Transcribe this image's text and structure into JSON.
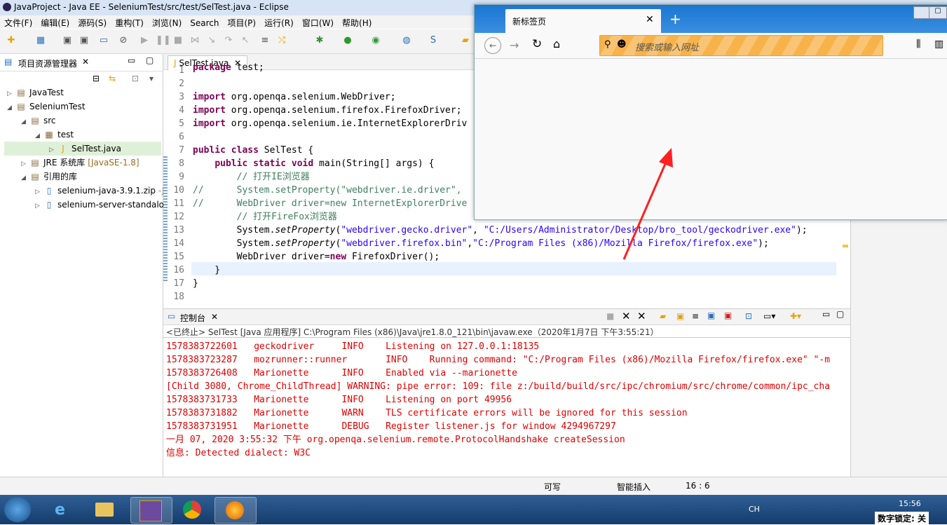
{
  "eclipse": {
    "title": "JavaProject - Java EE - SeleniumTest/src/test/SelTest.java - Eclipse",
    "menu": [
      "文件(F)",
      "编辑(E)",
      "源码(S)",
      "重构(T)",
      "浏览(N)",
      "Search",
      "项目(P)",
      "运行(R)",
      "窗口(W)",
      "帮助(H)"
    ],
    "explorer": {
      "title": "项目资源管理器",
      "items": [
        {
          "label": "JavaTest",
          "indent": 0,
          "arrow": "▷"
        },
        {
          "label": "SeleniumTest",
          "indent": 0,
          "arrow": "◢"
        },
        {
          "label": "src",
          "indent": 1,
          "arrow": "◢"
        },
        {
          "label": "test",
          "indent": 2,
          "arrow": "◢"
        },
        {
          "label": "SelTest.java",
          "indent": 3,
          "arrow": "▷"
        },
        {
          "label": "JRE 系统库",
          "suffix": "[JavaSE-1.8]",
          "indent": 1,
          "arrow": "▷"
        },
        {
          "label": "引用的库",
          "indent": 1,
          "arrow": "◢"
        },
        {
          "label": "selenium-java-3.9.1.zip",
          "suffix": "-Ja",
          "indent": 2,
          "arrow": "▷"
        },
        {
          "label": "selenium-server-standalo",
          "indent": 2,
          "arrow": "▷"
        }
      ]
    },
    "editor_tab": "SelTest.java",
    "code": [
      {
        "n": "1",
        "html": "package test;"
      },
      {
        "n": "2",
        "html": ""
      },
      {
        "n": "3",
        "html": "import org.openqa.selenium.WebDriver;"
      },
      {
        "n": "4",
        "html": "import org.openqa.selenium.firefox.FirefoxDriver;"
      },
      {
        "n": "5",
        "html": "import org.openqa.selenium.ie.InternetExplorerDriv"
      },
      {
        "n": "6",
        "html": ""
      },
      {
        "n": "7",
        "html": "public class SelTest {"
      },
      {
        "n": "8",
        "html": "    public static void main(String[] args) {"
      },
      {
        "n": "9",
        "html": "        // 打开IE浏览器"
      },
      {
        "n": "10",
        "html": "//      System.setProperty(\"webdriver.ie.driver\","
      },
      {
        "n": "11",
        "html": "//      WebDriver driver=new InternetExplorerDrive"
      },
      {
        "n": "12",
        "html": "        // 打开FireFox浏览器"
      },
      {
        "n": "13",
        "html": "        System.setProperty(\"webdriver.gecko.driver\", \"C:/Users/Administrator/Desktop/bro_tool/geckodriver.exe\");"
      },
      {
        "n": "14",
        "html": "        System.setProperty(\"webdriver.firefox.bin\",\"C:/Program Files (x86)/Mozilla Firefox/firefox.exe\");"
      },
      {
        "n": "15",
        "html": "        WebDriver driver=new FirefoxDriver();"
      },
      {
        "n": "16",
        "html": "    }"
      },
      {
        "n": "17",
        "html": "}"
      },
      {
        "n": "18",
        "html": ""
      }
    ],
    "console": {
      "title": "控制台",
      "status": "<已终止> SelTest [Java 应用程序] C:\\Program Files (x86)\\Java\\jre1.8.0_121\\bin\\javaw.exe（2020年1月7日 下午3:55:21）",
      "lines": [
        "1578383722601   geckodriver     INFO    Listening on 127.0.0.1:18135",
        "1578383723287   mozrunner::runner       INFO    Running command: \"C:/Program Files (x86)/Mozilla Firefox/firefox.exe\" \"-m",
        "1578383726408   Marionette      INFO    Enabled via --marionette",
        "[Child 3080, Chrome_ChildThread] WARNING: pipe error: 109: file z:/build/build/src/ipc/chromium/src/chrome/common/ipc_cha",
        "1578383731733   Marionette      INFO    Listening on port 49956",
        "1578383731882   Marionette      WARN    TLS certificate errors will be ignored for this session",
        "1578383731951   Marionette      DEBUG   Register listener.js for window 4294967297",
        "一月 07, 2020 3:55:32 下午 org.openqa.selenium.remote.ProtocolHandshake createSession",
        "信息: Detected dialect: W3C"
      ]
    },
    "statusbar": {
      "writable": "可写",
      "insert": "智能插入",
      "position": "16 : 6"
    }
  },
  "firefox": {
    "tab_title": "新标签页",
    "url_placeholder": "搜索或输入网址"
  },
  "taskbar": {
    "time": "15:56",
    "lang": "CH",
    "numlock": "数字锁定: 关"
  }
}
